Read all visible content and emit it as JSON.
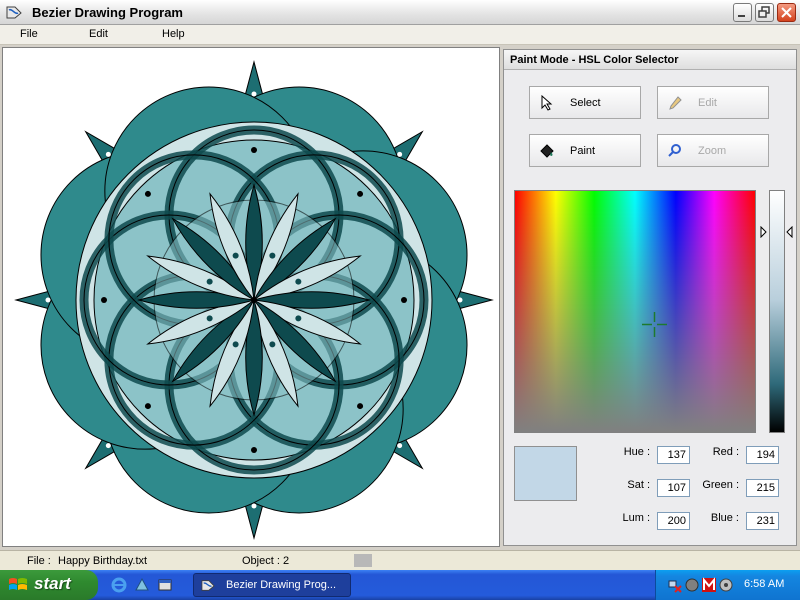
{
  "window": {
    "title": "Bezier Drawing Program"
  },
  "menu": {
    "items": [
      "File",
      "Edit",
      "Help"
    ]
  },
  "panel": {
    "title": "Paint Mode - HSL Color Selector",
    "tools": {
      "select": "Select",
      "edit": "Edit",
      "paint": "Paint",
      "zoom": "Zoom"
    },
    "fields": {
      "hue_label": "Hue :",
      "hue": "137",
      "sat_label": "Sat :",
      "sat": "107",
      "lum_label": "Lum :",
      "lum": "200",
      "red_label": "Red :",
      "red": "194",
      "green_label": "Green :",
      "green": "215",
      "blue_label": "Blue :",
      "blue": "231"
    }
  },
  "status": {
    "file_label": "File  :",
    "file_value": "Happy Birthday.txt",
    "object": "Object : 2"
  },
  "taskbar": {
    "start": "start",
    "task": "Bezier Drawing Prog...",
    "clock": "6:58 AM"
  },
  "colors": {
    "dark_teal": "#1d6e72",
    "mid_teal": "#2f8a8c",
    "light_teal": "#8cc3c8",
    "pale_teal": "#cfe4e6",
    "deep_teal": "#0e4a4e",
    "swatch": "#c2d7e7"
  }
}
